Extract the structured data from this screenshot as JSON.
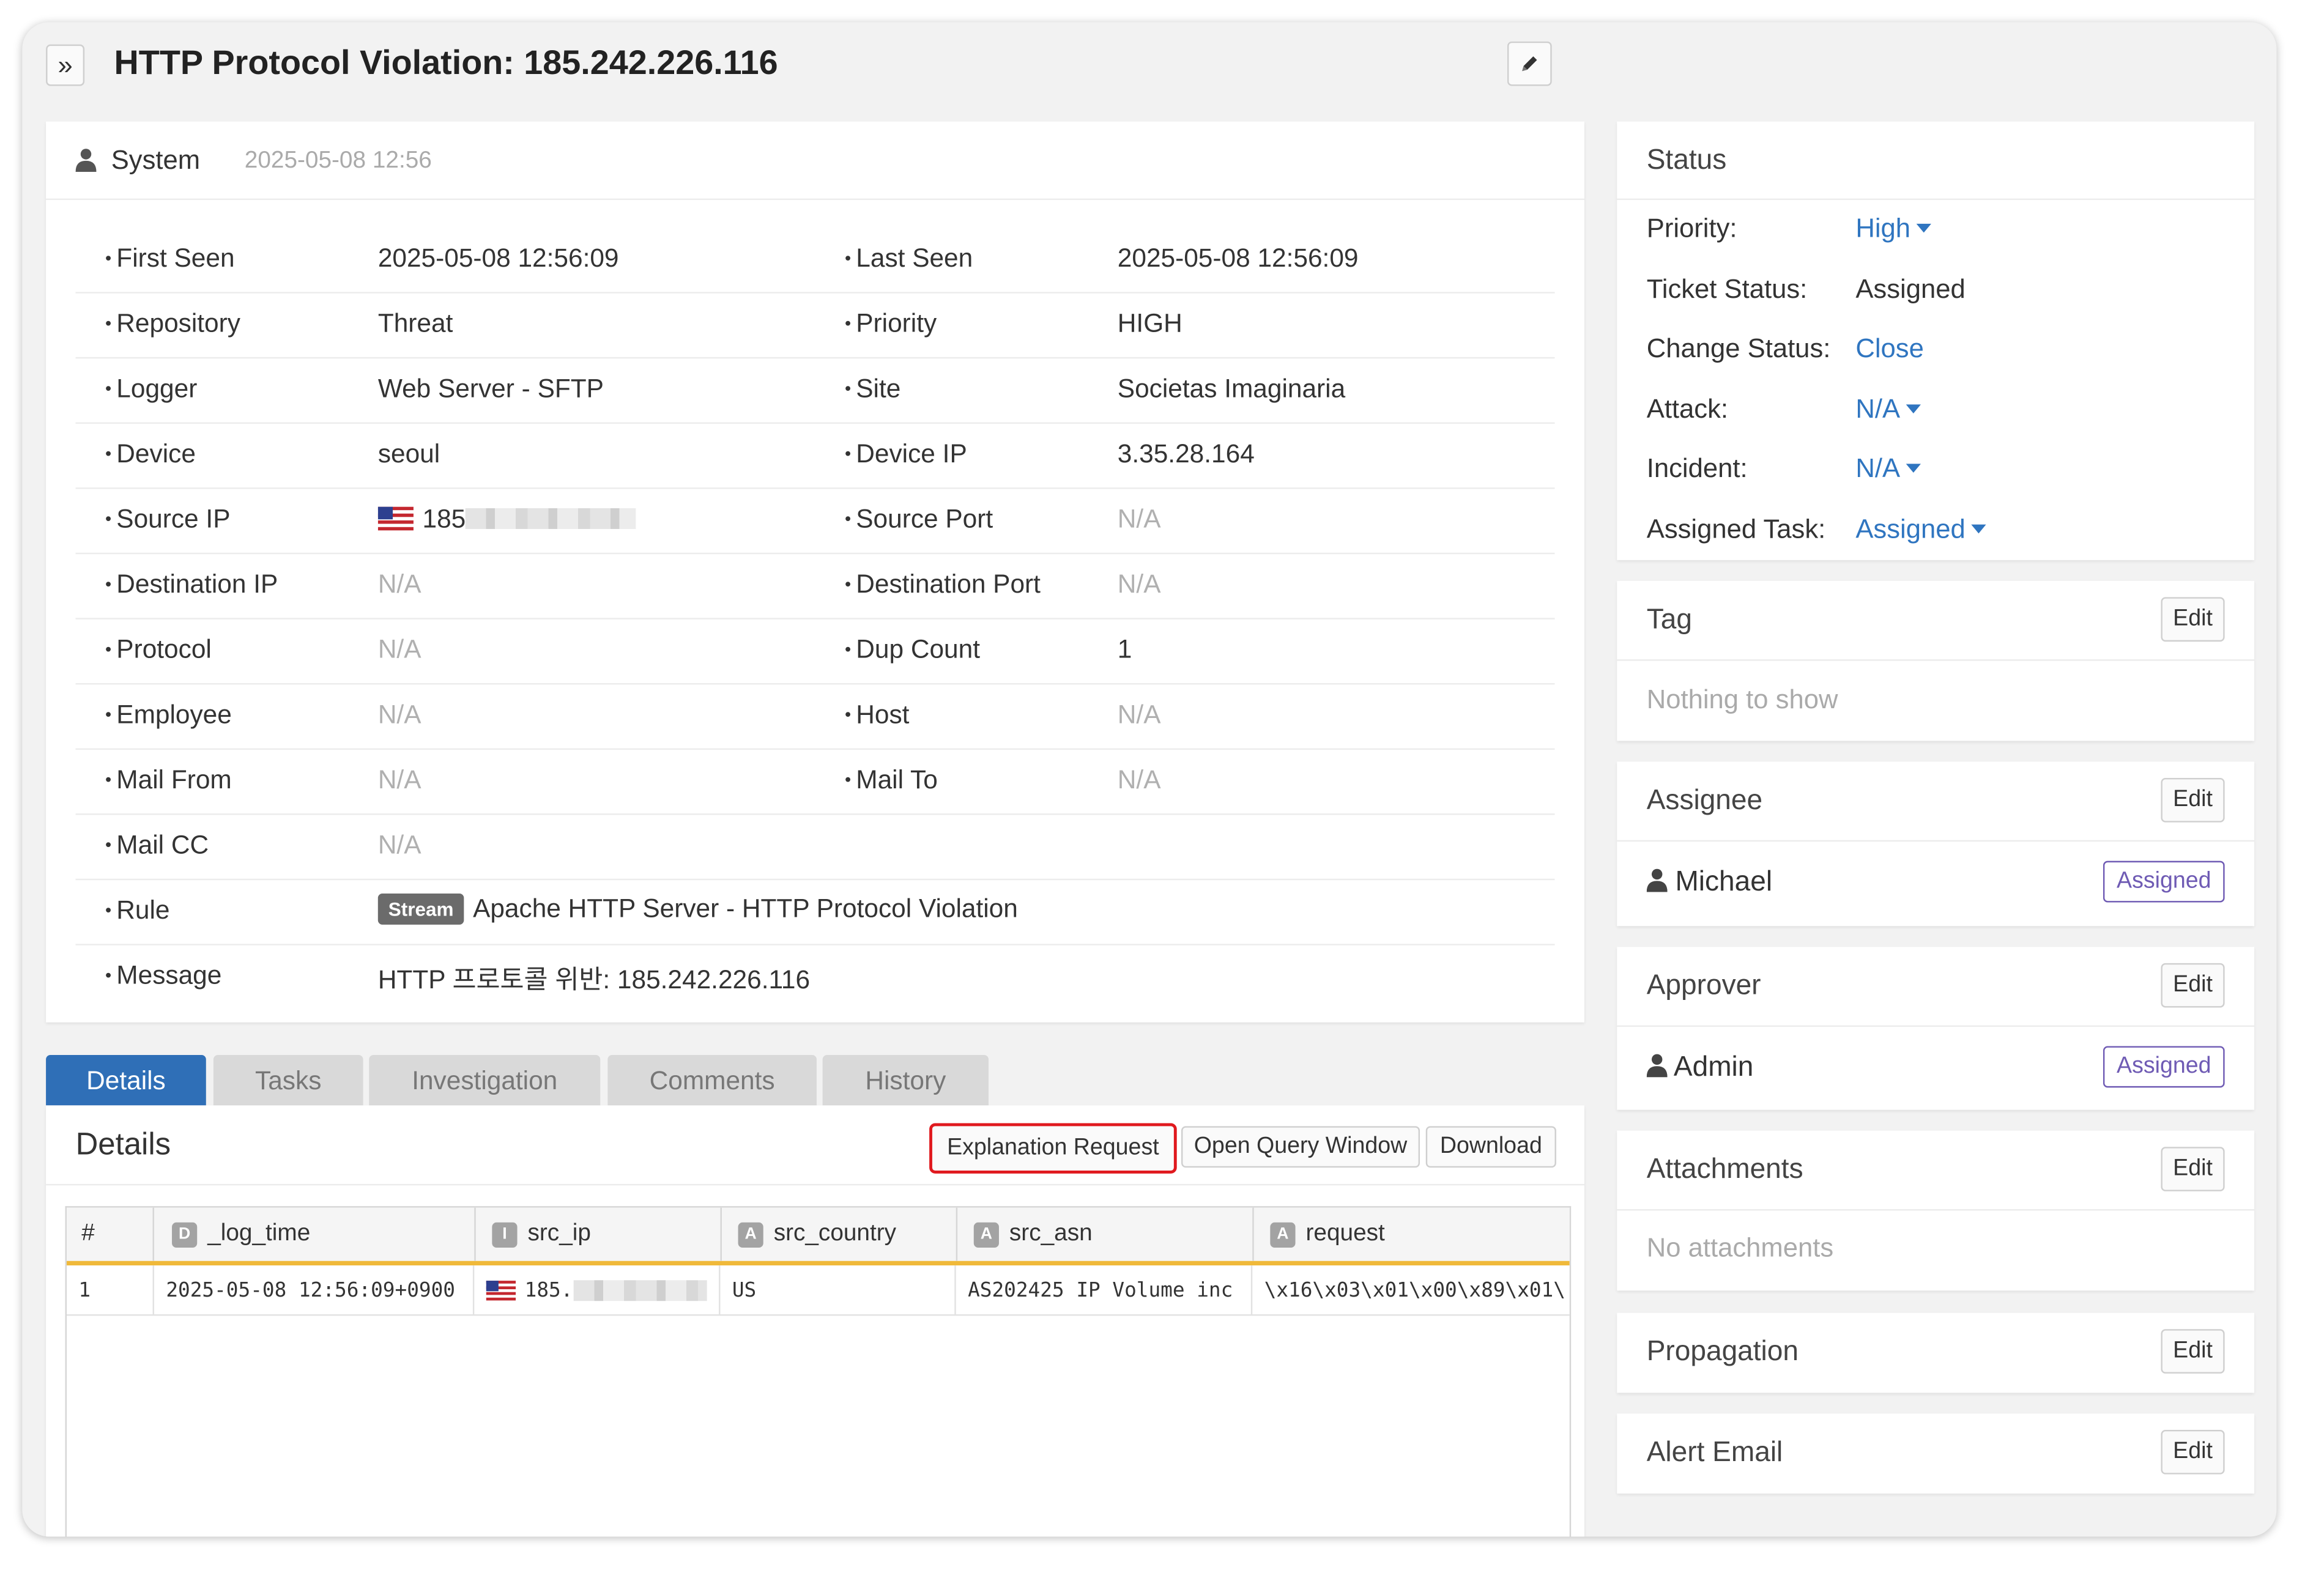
{
  "header": {
    "expand_icon": "»",
    "title": "HTTP Protocol Violation: 185.242.226.116",
    "edit_icon": "pencil-icon"
  },
  "meta": {
    "author": "System",
    "date": "2025-05-08 12:56",
    "rows": [
      {
        "l1": "First Seen",
        "v1": "2025-05-08 12:56:09",
        "l2": "Last Seen",
        "v2": "2025-05-08 12:56:09"
      },
      {
        "l1": "Repository",
        "v1": "Threat",
        "l2": "Priority",
        "v2": "HIGH"
      },
      {
        "l1": "Logger",
        "v1": "Web Server - SFTP",
        "l2": "Site",
        "v2": "Societas Imaginaria"
      },
      {
        "l1": "Device",
        "v1": "seoul",
        "l2": "Device IP",
        "v2": "3.35.28.164"
      },
      {
        "l1": "Source IP",
        "v1": "185",
        "l2": "Source Port",
        "v2": "N/A"
      },
      {
        "l1": "Destination IP",
        "v1": "N/A",
        "l2": "Destination Port",
        "v2": "N/A"
      },
      {
        "l1": "Protocol",
        "v1": "N/A",
        "l2": "Dup Count",
        "v2": "1"
      },
      {
        "l1": "Employee",
        "v1": "N/A",
        "l2": "Host",
        "v2": "N/A"
      },
      {
        "l1": "Mail From",
        "v1": "N/A",
        "l2": "Mail To",
        "v2": "N/A"
      },
      {
        "l1": "Mail CC",
        "v1": "N/A"
      },
      {
        "l1": "Rule",
        "badge": "Stream",
        "v1": "Apache HTTP Server - HTTP Protocol Violation"
      },
      {
        "l1": "Message",
        "v1": "HTTP 프로토콜 위반: 185.242.226.116"
      }
    ]
  },
  "tabs": [
    "Details",
    "Tasks",
    "Investigation",
    "Comments",
    "History"
  ],
  "details": {
    "title": "Details",
    "buttons": {
      "explain": "Explanation Request",
      "query": "Open Query Window",
      "download": "Download"
    },
    "columns": [
      {
        "name": "#",
        "type": ""
      },
      {
        "name": "_log_time",
        "type": "D"
      },
      {
        "name": "src_ip",
        "type": "I"
      },
      {
        "name": "src_country",
        "type": "A"
      },
      {
        "name": "src_asn",
        "type": "A"
      },
      {
        "name": "request",
        "type": "A"
      }
    ],
    "row": [
      "1",
      "2025-05-08 12:56:09+0900",
      "185.",
      "US",
      "AS202425 IP Volume inc",
      "\\x16\\x03\\x01\\x00\\x89\\x01\\"
    ]
  },
  "status": {
    "title": "Status",
    "items": [
      {
        "label": "Priority:",
        "value": "High"
      },
      {
        "label": "Ticket Status:",
        "value": "Assigned"
      },
      {
        "label": "Change Status:",
        "value": "Close"
      },
      {
        "label": "Attack:",
        "value": "N/A"
      },
      {
        "label": "Incident:",
        "value": "N/A"
      },
      {
        "label": "Assigned Task:",
        "value": "Assigned"
      }
    ]
  },
  "tag": {
    "title": "Tag",
    "edit": "Edit",
    "empty": "Nothing to show"
  },
  "assignee": {
    "title": "Assignee",
    "edit": "Edit",
    "name": "Michael",
    "badge": "Assigned"
  },
  "approver": {
    "title": "Approver",
    "edit": "Edit",
    "name": "Admin",
    "badge": "Assigned"
  },
  "attachments": {
    "title": "Attachments",
    "edit": "Edit",
    "empty": "No attachments"
  },
  "propagation": {
    "title": "Propagation",
    "edit": "Edit"
  },
  "alert_email": {
    "title": "Alert Email",
    "edit": "Edit"
  },
  "colors": {
    "accent": "#2f6fb7",
    "link": "#2f75c0",
    "badge": "#6f5bb4",
    "highlight": "#e0191e",
    "grid_header_border": "#f0b93a"
  }
}
